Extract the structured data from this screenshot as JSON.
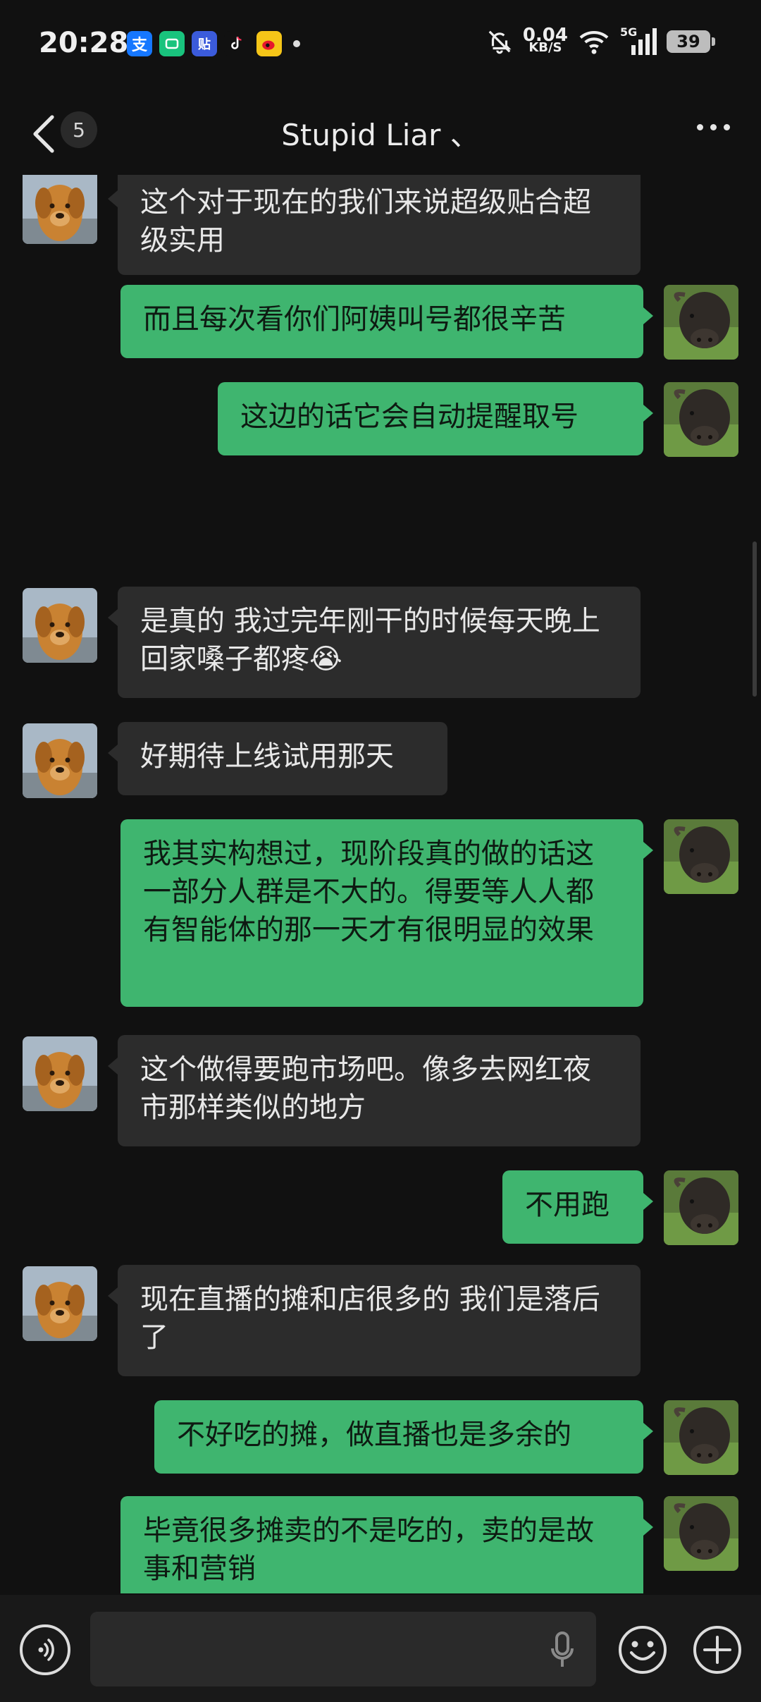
{
  "status_bar": {
    "time": "20:28",
    "net_speed_value": "0.04",
    "net_speed_unit": "KB/S",
    "signal_label": "5G",
    "battery": "39",
    "app_icons": [
      "alipay-icon",
      "taobao-icon",
      "tieba-icon",
      "douyin-icon",
      "weibo-icon"
    ]
  },
  "header": {
    "back_count": "5",
    "title": "Stupid Liar 、",
    "more_label": "more"
  },
  "messages": [
    {
      "side": "in",
      "text": "这个对于现在的我们来说超级贴合超级实用"
    },
    {
      "side": "out",
      "text": "而且每次看你们阿姨叫号都很辛苦"
    },
    {
      "side": "out",
      "text": "这边的话它会自动提醒取号"
    },
    {
      "side": "in",
      "text": "是真的 我过完年刚干的时候每天晚上回家嗓子都疼😭"
    },
    {
      "side": "in",
      "text": "好期待上线试用那天"
    },
    {
      "side": "out",
      "text": "我其实构想过，现阶段真的做的话这一部分人群是不大的。得要等人人都有智能体的那一天才有很明显的效果"
    },
    {
      "side": "in",
      "text": "这个做得要跑市场吧。像多去网红夜市那样类似的地方"
    },
    {
      "side": "out",
      "text": "不用跑"
    },
    {
      "side": "in",
      "text": "现在直播的摊和店很多的 我们是落后了"
    },
    {
      "side": "out",
      "text": "不好吃的摊，做直播也是多余的"
    },
    {
      "side": "out",
      "text": "毕竟很多摊卖的不是吃的，卖的是故事和营销"
    }
  ],
  "input_bar": {
    "placeholder": "",
    "value": ""
  },
  "colors": {
    "background": "#111111",
    "bubble_in": "#2c2c2c",
    "bubble_out": "#3fb56f"
  }
}
